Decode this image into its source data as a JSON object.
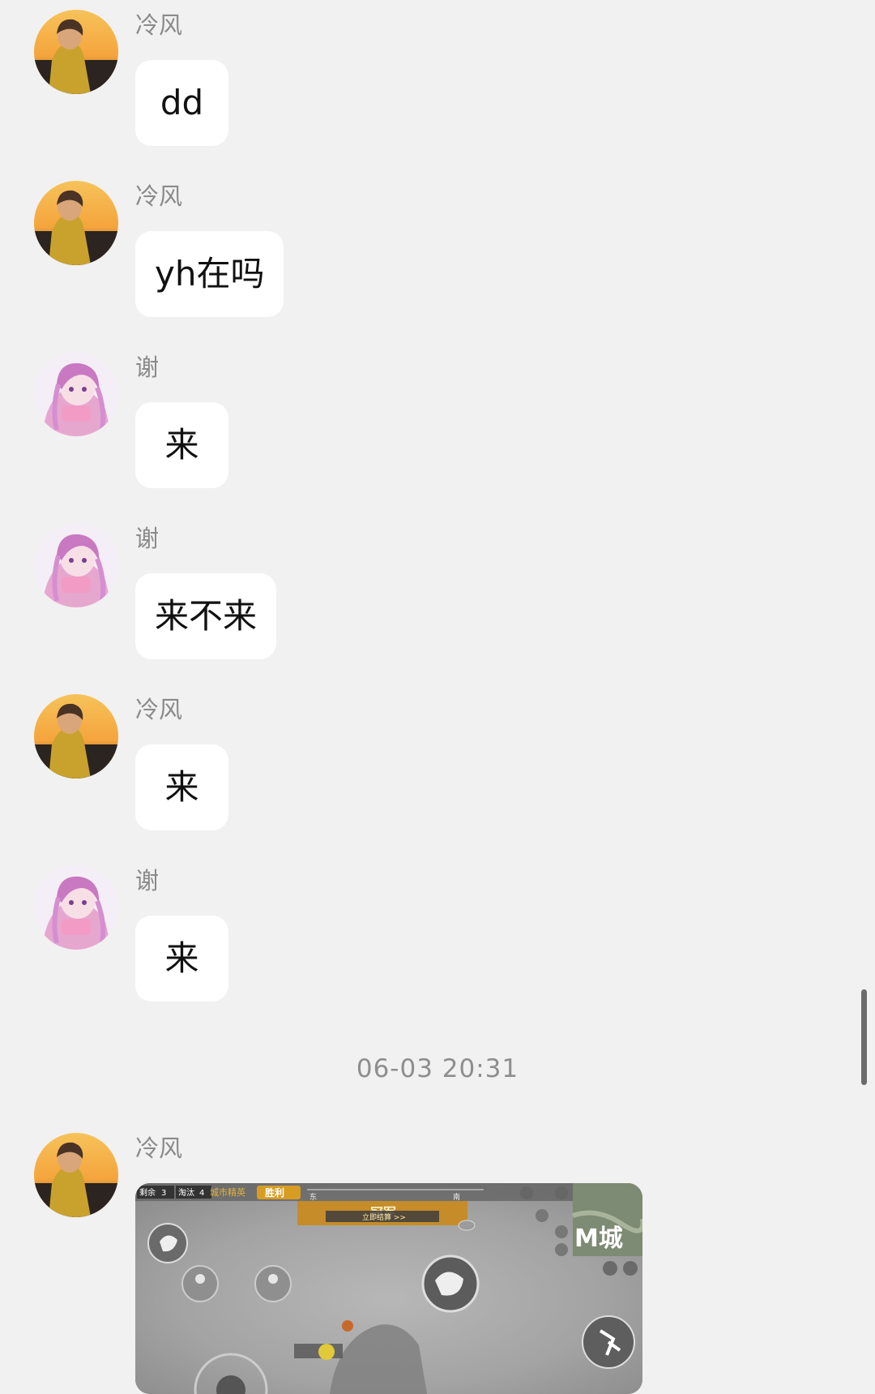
{
  "messages": [
    {
      "sender": "冷风",
      "avatar": "sunset-boy-avatar",
      "text": "dd"
    },
    {
      "sender": "冷风",
      "avatar": "sunset-boy-avatar",
      "text": "yh在吗"
    },
    {
      "sender": "谢",
      "avatar": "anime-girl-avatar",
      "text": "来"
    },
    {
      "sender": "谢",
      "avatar": "anime-girl-avatar",
      "text": "来不来"
    },
    {
      "sender": "冷风",
      "avatar": "sunset-boy-avatar",
      "text": "来"
    },
    {
      "sender": "谢",
      "avatar": "anime-girl-avatar",
      "text": "来"
    }
  ],
  "timestamp": "06-03 20:31",
  "image_message": {
    "sender": "冷风",
    "avatar": "sunset-boy-avatar",
    "game_hud": {
      "remaining_label": "剩余",
      "remaining_value": "3",
      "eliminated_label": "淘汰",
      "eliminated_value": "4",
      "mode_label": "城市精英",
      "victory_label": "胜利",
      "champion_label": "冠军",
      "settle_label": "立即结算 >>",
      "compass": [
        "东",
        "南"
      ],
      "map_text": "M城"
    }
  },
  "colors": {
    "background": "#f1f1f1",
    "bubble": "#ffffff",
    "sender_text": "#8a8a8a",
    "message_text": "#111111",
    "timestamp_text": "#8e8e8e"
  }
}
